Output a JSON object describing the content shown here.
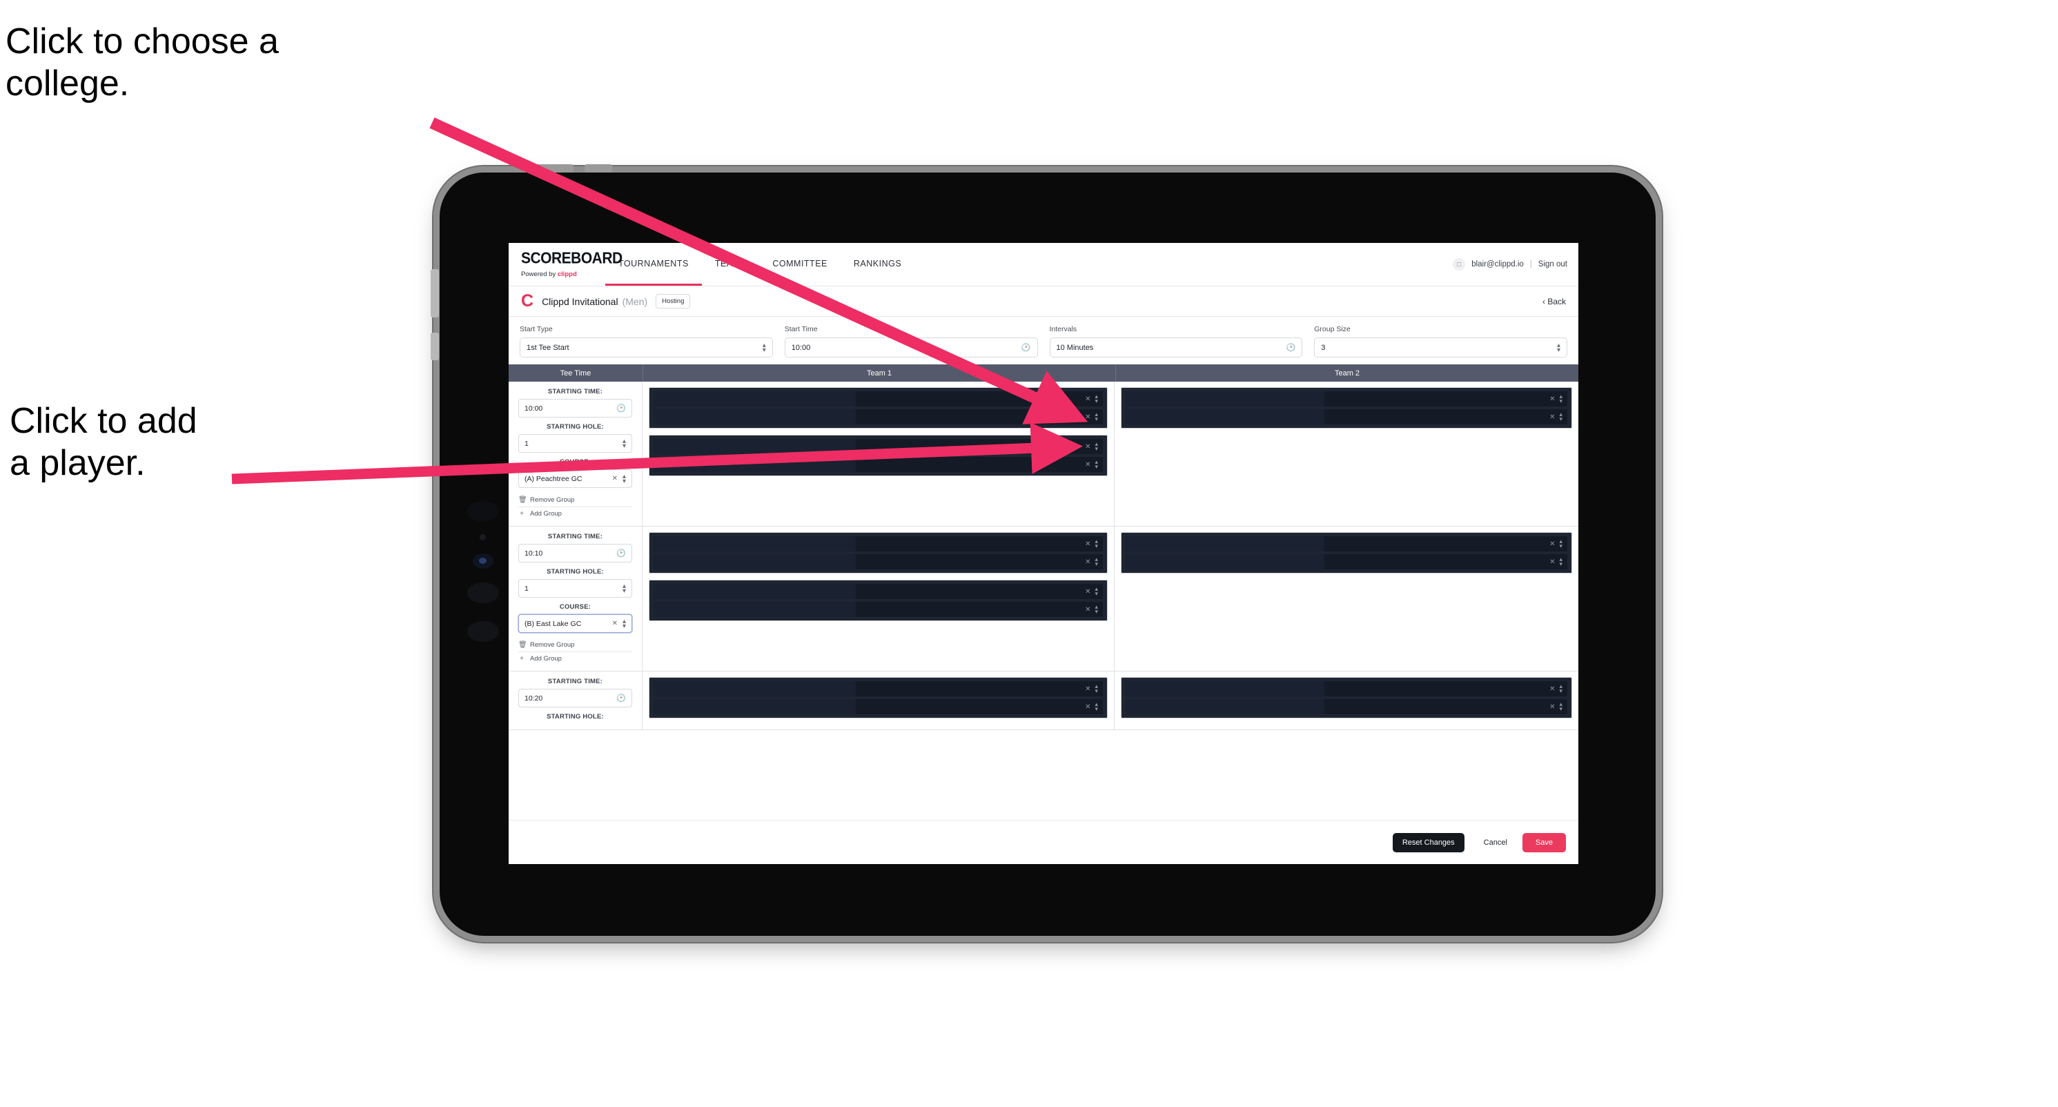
{
  "annotations": [
    {
      "id": "choose-college",
      "text": "Click to choose a\ncollege."
    },
    {
      "id": "add-player",
      "text": "Click to add\na player."
    }
  ],
  "app": {
    "nav": {
      "brand_title": "SCOREBOARD",
      "brand_sub_prefix": "Powered by ",
      "brand_sub_name": "clippd",
      "links": [
        {
          "label": "TOURNAMENTS",
          "active": true
        },
        {
          "label": "TEAMS",
          "active": false
        },
        {
          "label": "COMMITTEE",
          "active": false
        },
        {
          "label": "RANKINGS",
          "active": false
        }
      ],
      "account_icon": "user-avatar-icon",
      "account_email": "blair@clippd.io",
      "separator": "|",
      "sign_out": "Sign out"
    },
    "tournament_bar": {
      "logo_letter": "C",
      "name": "Clippd Invitational",
      "gender": "(Men)",
      "badge": "Hosting",
      "back_chevron": "‹",
      "back_label": "Back"
    },
    "controls": [
      {
        "label": "Start Type",
        "value": "1st Tee Start",
        "icon": "stepper-icon"
      },
      {
        "label": "Start Time",
        "value": "10:00",
        "icon": "clock-icon"
      },
      {
        "label": "Intervals",
        "value": "10 Minutes",
        "icon": "clock-icon"
      },
      {
        "label": "Group Size",
        "value": "3",
        "icon": "stepper-icon"
      }
    ],
    "table": {
      "headers": [
        "Tee Time",
        "Team 1",
        "Team 2"
      ],
      "labels": {
        "starting_time": "STARTING TIME:",
        "starting_hole": "STARTING HOLE:",
        "course": "COURSE:",
        "remove_group": "Remove Group",
        "add_group": "Add Group"
      },
      "rows": [
        {
          "starting_time": "10:00",
          "starting_hole": "1",
          "course": "(A) Peachtree GC",
          "course_focused": false,
          "team1_groups": [
            2,
            2
          ],
          "team2_groups": [
            2
          ]
        },
        {
          "starting_time": "10:10",
          "starting_hole": "1",
          "course": "(B) East Lake GC",
          "course_focused": true,
          "team1_groups": [
            2,
            2
          ],
          "team2_groups": [
            2
          ]
        },
        {
          "starting_time": "10:20",
          "starting_hole": "",
          "course": "",
          "course_focused": false,
          "team1_groups": [
            2
          ],
          "team2_groups": [
            2
          ]
        }
      ]
    },
    "footer": {
      "reset": "Reset Changes",
      "cancel": "Cancel",
      "save": "Save"
    }
  },
  "colors": {
    "accent_pink": "#e8315c",
    "save_pink": "#eb3a5e",
    "table_header": "#545a6b",
    "player_row_dark": "#141a26",
    "group_box_dark": "#1f2532",
    "annotation_arrow": "#ed2d63"
  }
}
